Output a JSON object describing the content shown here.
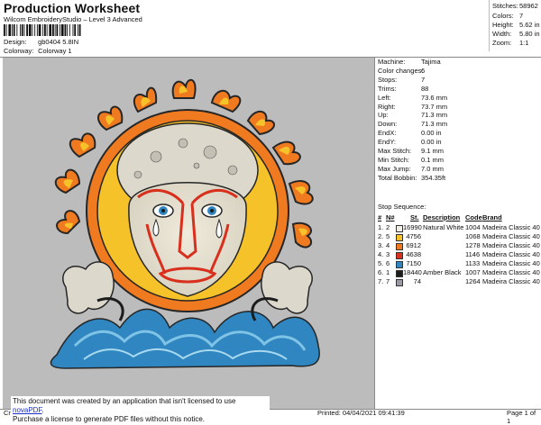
{
  "header": {
    "title": "Production Worksheet",
    "subtitle": "Wilcom EmbroideryStudio – Level 3 Advanced",
    "design_label": "Design:",
    "design_value": "gb0404 5.8IN",
    "colorway_label": "Colorway:",
    "colorway_value": "Colorway 1"
  },
  "stats": [
    {
      "label": "Stitches:",
      "value": "58962"
    },
    {
      "label": "Colors:",
      "value": "7"
    },
    {
      "label": "Height:",
      "value": "5.62 in"
    },
    {
      "label": "Width:",
      "value": "5.80 in"
    },
    {
      "label": "Zoom:",
      "value": "1:1"
    }
  ],
  "machine_info": [
    {
      "label": "Machine:",
      "value": "Tajima"
    },
    {
      "label": "Color changes:",
      "value": "6"
    },
    {
      "label": "Stops:",
      "value": "7"
    },
    {
      "label": "Trims:",
      "value": "88"
    },
    {
      "label": "Left:",
      "value": "73.6 mm"
    },
    {
      "label": "Right:",
      "value": "73.7 mm"
    },
    {
      "label": "Up:",
      "value": "71.3 mm"
    },
    {
      "label": "Down:",
      "value": "71.3 mm"
    },
    {
      "label": "EndX:",
      "value": "0.00 in"
    },
    {
      "label": "EndY:",
      "value": "0.00 in"
    },
    {
      "label": "Max Stitch:",
      "value": "9.1 mm"
    },
    {
      "label": "Min Stitch:",
      "value": "0.1 mm"
    },
    {
      "label": "Max Jump:",
      "value": "7.0 mm"
    },
    {
      "label": "Total Bobbin:",
      "value": "354.35ft"
    }
  ],
  "stop_sequence": {
    "title": "Stop Sequence:",
    "headers": {
      "idx": "#",
      "n": "N#",
      "st": "St.",
      "description": "Description",
      "code": "Code",
      "brand": "Brand"
    },
    "rows": [
      {
        "idx": "1.",
        "n": "2",
        "color": "#f2efe6",
        "st": "16990",
        "description": "Natural White",
        "code": "1004",
        "brand": "Madeira Classic 40"
      },
      {
        "idx": "2.",
        "n": "5",
        "color": "#f6c22a",
        "st": "4756",
        "description": "",
        "code": "1068",
        "brand": "Madeira Classic 40"
      },
      {
        "idx": "3.",
        "n": "4",
        "color": "#f07a20",
        "st": "6912",
        "description": "",
        "code": "1278",
        "brand": "Madeira Classic 40"
      },
      {
        "idx": "4.",
        "n": "3",
        "color": "#d8301c",
        "st": "4638",
        "description": "",
        "code": "1146",
        "brand": "Madeira Classic 40"
      },
      {
        "idx": "5.",
        "n": "6",
        "color": "#2f86c0",
        "st": "7150",
        "description": "",
        "code": "1133",
        "brand": "Madeira Classic 40"
      },
      {
        "idx": "6.",
        "n": "1",
        "color": "#1c1c1c",
        "st": "18440",
        "description": "Amber Black",
        "code": "1007",
        "brand": "Madeira Classic 40"
      },
      {
        "idx": "7.",
        "n": "7",
        "color": "#9a9aa4",
        "st": "74",
        "description": "",
        "code": "1264",
        "brand": "Madeira Classic 40"
      }
    ]
  },
  "footer": {
    "left": "Cr",
    "printed": "Printed: 04/04/2021 09:41:39",
    "page": "Page 1 of 1"
  },
  "notice": {
    "line1_pre": "This document was created by an application that isn't licensed to use ",
    "link": "novaPDF",
    "line1_post": ".",
    "line2": "Purchase a license to generate PDF files without this notice."
  }
}
